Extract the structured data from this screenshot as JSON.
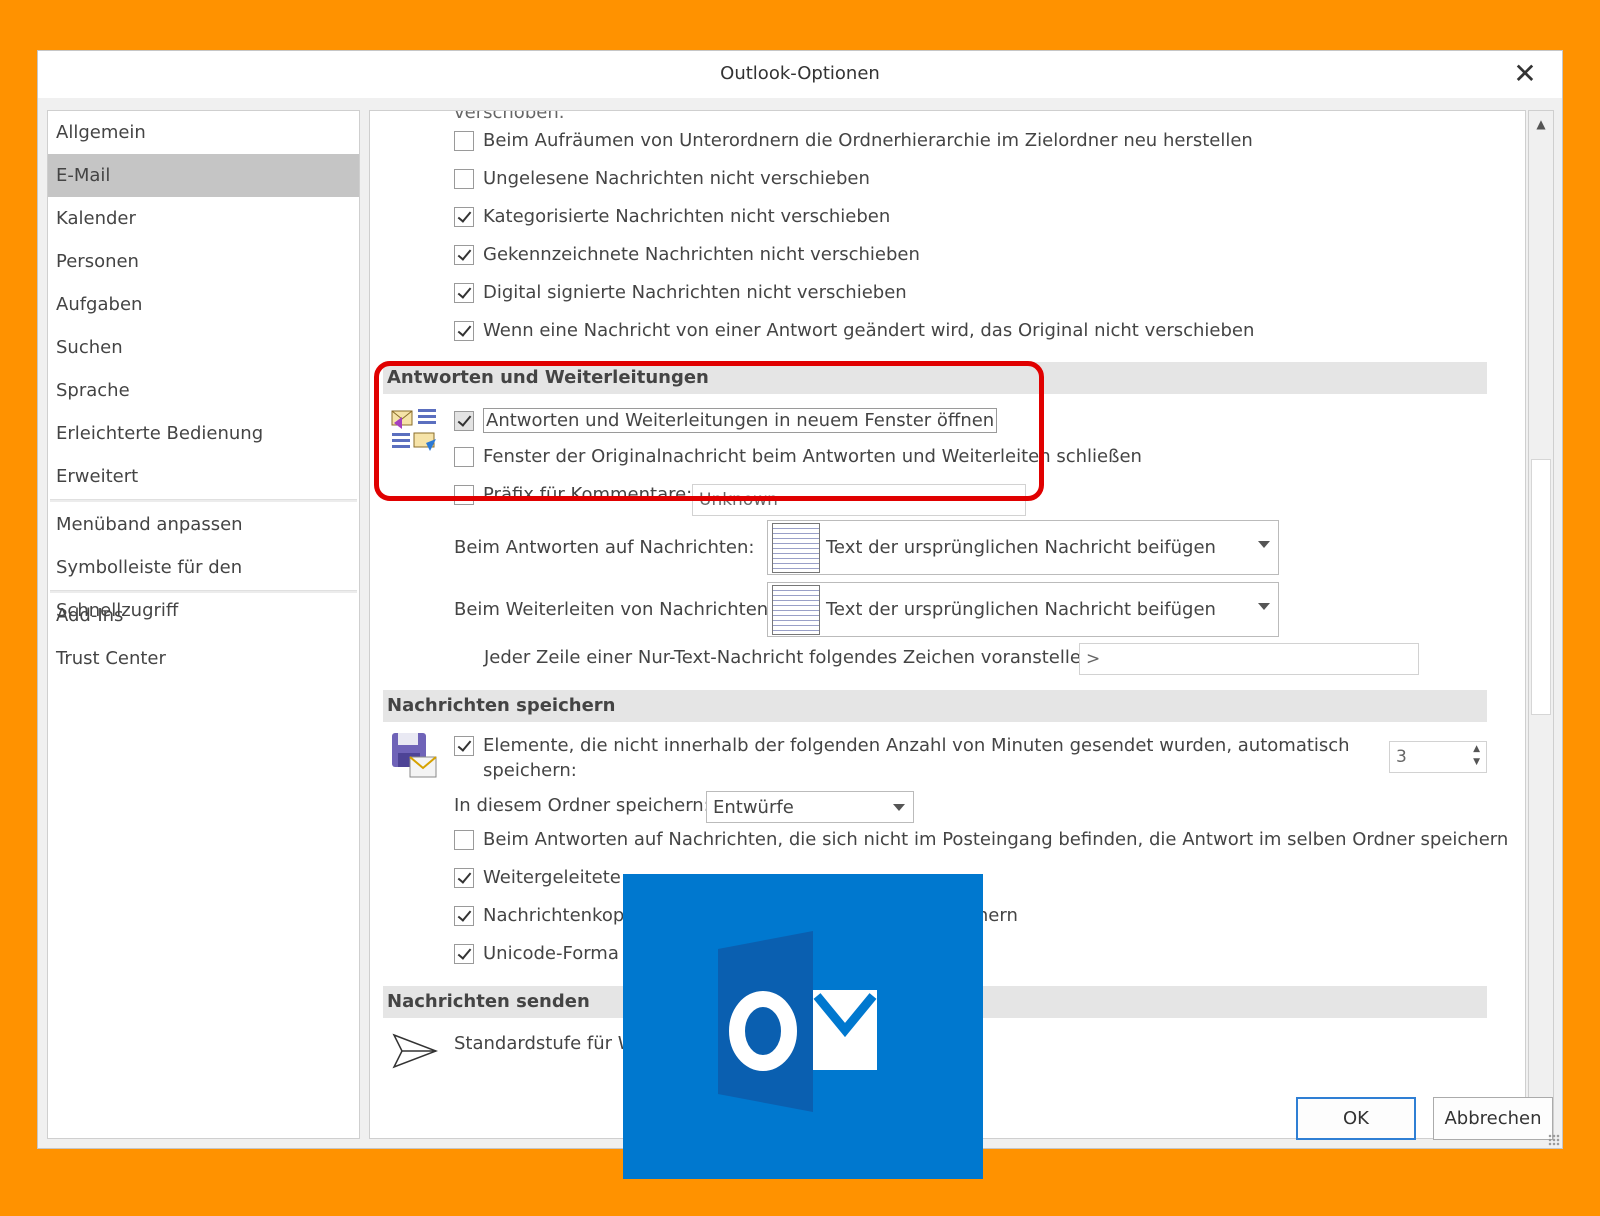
{
  "dialog": {
    "title": "Outlook-Optionen",
    "close_icon": "✕"
  },
  "nav": {
    "items": [
      "Allgemein",
      "E-Mail",
      "Kalender",
      "Personen",
      "Aufgaben",
      "Suchen",
      "Sprache",
      "Erleichterte Bedienung",
      "Erweitert"
    ],
    "items2": [
      "Menüband anpassen",
      "Symbolleiste für den Schnellzugriff"
    ],
    "items3": [
      "Add-Ins",
      "Trust Center"
    ],
    "selected": "E-Mail"
  },
  "content": {
    "cut_top_text": "verschoben.",
    "cleanup": [
      {
        "label": "Beim Aufräumen von Unterordnern die Ordnerhierarchie im Zielordner neu herstellen",
        "checked": false
      },
      {
        "label": "Ungelesene Nachrichten nicht verschieben",
        "checked": false
      },
      {
        "label": "Kategorisierte Nachrichten nicht verschieben",
        "checked": true
      },
      {
        "label": "Gekennzeichnete Nachrichten nicht verschieben",
        "checked": true
      },
      {
        "label": "Digital signierte Nachrichten nicht verschieben",
        "checked": true
      },
      {
        "label": "Wenn eine Nachricht von einer Antwort geändert wird, das Original nicht verschieben",
        "checked": true
      }
    ],
    "replies": {
      "heading": "Antworten und Weiterleitungen",
      "open_new_window": {
        "label": "Antworten und Weiterleitungen in neuem Fenster öffnen",
        "checked": true
      },
      "close_original": {
        "label": "Fenster der Originalnachricht beim Antworten und Weiterleiten schließen",
        "checked": false
      },
      "prefix": {
        "label": "Präfix für Kommentare:",
        "checked": false,
        "value": "Unknown"
      },
      "on_reply_label": "Beim Antworten auf Nachrichten:",
      "on_reply_value": "Text der ursprünglichen Nachricht beifügen",
      "on_forward_label": "Beim Weiterleiten von Nachrichten:",
      "on_forward_value": "Text der ursprünglichen Nachricht beifügen",
      "prefix_char_label": "Jeder Zeile einer Nur-Text-Nachricht folgendes Zeichen voranstellen:",
      "prefix_char_value": ">"
    },
    "save": {
      "heading": "Nachrichten speichern",
      "autosave": {
        "label_line1": "Elemente, die nicht innerhalb der folgenden Anzahl von Minuten gesendet wurden, automatisch",
        "label_line2": "speichern:",
        "checked": true,
        "minutes": "3"
      },
      "folder_label": "In diesem Ordner speichern:",
      "folder_value": "Entwürfe",
      "reply_same_folder": {
        "label": "Beim Antworten auf Nachrichten, die sich nicht im Posteingang befinden, die Antwort im selben Ordner speichern",
        "checked": false
      },
      "forwarded": {
        "label": "Weitergeleitete",
        "checked": true
      },
      "copies": {
        "label": "Nachrichtenkop",
        "tail": "chern",
        "checked": true
      },
      "unicode": {
        "label": "Unicode-Forma",
        "checked": true
      }
    },
    "send": {
      "heading": "Nachrichten senden",
      "importance_label": "Standardstufe für W"
    }
  },
  "buttons": {
    "ok": "OK",
    "cancel": "Abbrechen"
  },
  "colors": {
    "background": "#ff9200",
    "highlight": "#e00000",
    "outlook_blue": "#0078cf"
  }
}
